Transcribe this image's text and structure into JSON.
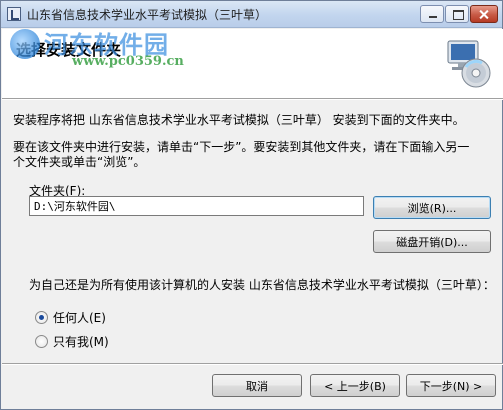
{
  "window": {
    "title": "山东省信息技术学业水平考试模拟（三叶草）"
  },
  "header": {
    "title": "选择安装文件夹",
    "watermark_text": "河东软件园",
    "watermark_url": "www.pc0359.cn",
    "icon": "installer-cd-computer-icon"
  },
  "body": {
    "line1": "安装程序将把 山东省信息技术学业水平考试模拟（三叶草） 安装到下面的文件夹中。",
    "line2": "要在该文件夹中进行安装，请单击“下一步”。要安装到其他文件夹，请在下面输入另一",
    "line3": "个文件夹或单击“浏览”。"
  },
  "folder": {
    "label": "文件夹(F):",
    "value": "D:\\河东软件园\\"
  },
  "buttons": {
    "browse": "浏览(R)...",
    "disk_cost": "磁盘开销(D)...",
    "cancel": "取消",
    "back": "< 上一步(B)",
    "next": "下一步(N) >"
  },
  "install_for": {
    "question": "为自己还是为所有使用该计算机的人安装 山东省信息技术学业水平考试模拟（三叶草）：",
    "options": [
      {
        "label": "任何人(E)",
        "selected": true
      },
      {
        "label": "只有我(M)",
        "selected": false
      }
    ]
  },
  "colors": {
    "window_bg": "#f0f0f0",
    "titlebar": "#c2d5ee",
    "close_button": "#c75a46",
    "watermark_blue": "#3d8fe0",
    "watermark_green": "#2e9a3a"
  }
}
